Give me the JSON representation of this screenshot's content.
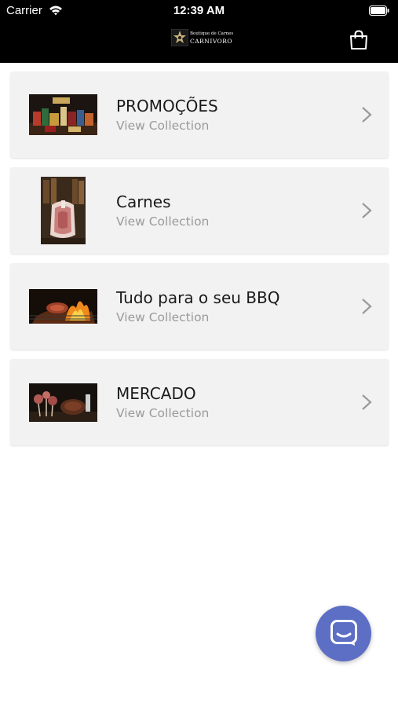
{
  "status_bar": {
    "carrier": "Carrier",
    "time": "12:39 AM"
  },
  "header": {
    "logo_line1": "Boutique de Carnes",
    "logo_line2": "CARNIVORO",
    "cart_icon": "shopping-bag-icon"
  },
  "collections": [
    {
      "title": "PROMOÇÕES",
      "subtitle": "View Collection",
      "image": "promo-products-photo"
    },
    {
      "title": "Carnes",
      "subtitle": "View Collection",
      "image": "raw-meat-photo"
    },
    {
      "title": "Tudo para o seu BBQ",
      "subtitle": "View Collection",
      "image": "bbq-fire-photo"
    },
    {
      "title": "MERCADO",
      "subtitle": "View Collection",
      "image": "meat-cuts-photo"
    }
  ],
  "chat_button": {
    "icon": "chat-bubble-icon",
    "color": "#5d6ec5"
  },
  "colors": {
    "header_bg": "#000000",
    "card_bg": "#f2f2f2",
    "subtitle": "#9a9a9a"
  }
}
